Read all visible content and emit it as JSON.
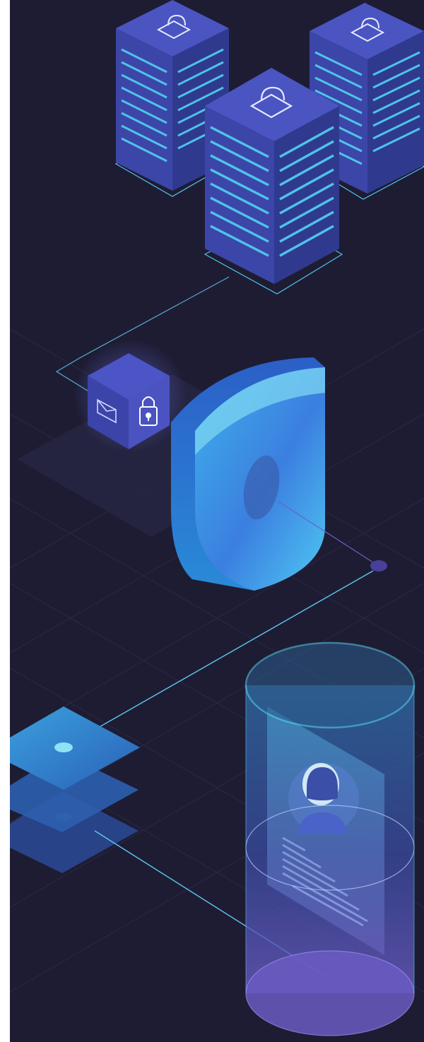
{
  "illustration": {
    "colors": {
      "background": "#1e1c33",
      "grid": "#2a2a48",
      "server_side": "#2f3a8f",
      "server_top": "#4a55c2",
      "server_front": "#3b46a8",
      "stripe": "#4fc3e8",
      "shield_edge": "#2f72d8",
      "shield_face": "#3aa6e6",
      "connector": "#5ec8f0",
      "node": "#4a3f9a",
      "cube_top": "#4b55c6",
      "cube_side": "#3b44a8",
      "cylinder_rim": "#57d3f2",
      "cylinder_body": "#3b4ea8",
      "cylinder_base": "#6a5bc2",
      "plate": "#3a83c8"
    },
    "icons": {
      "server_lock": "lock-icon",
      "cube_mail": "envelope-icon",
      "cube_lock": "lock-icon",
      "profile": "user-avatar-icon"
    }
  }
}
